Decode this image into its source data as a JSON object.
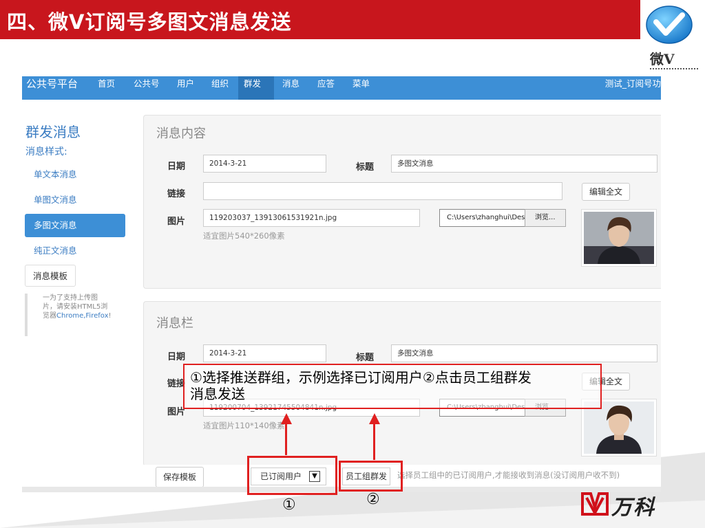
{
  "slide": {
    "title": "四、微V订阅号多图文消息发送",
    "logo_text": "微V"
  },
  "nav": {
    "brand": "公共号平台",
    "items": [
      "首页",
      "公共号",
      "用户",
      "组织",
      "群发",
      "消息",
      "应答",
      "菜单"
    ],
    "active_index": 4,
    "user": "测试_订阅号功"
  },
  "sidebar": {
    "title": "群发消息",
    "subtitle": "消息样式:",
    "items": [
      {
        "label": "单文本消息"
      },
      {
        "label": "单图文消息"
      },
      {
        "label": "多图文消息"
      },
      {
        "label": "纯正文消息"
      }
    ],
    "active_index": 2,
    "template_label": "消息模板",
    "note_line1": "一为了支持上传图",
    "note_line2": "片，请安装HTML5浏",
    "note_line3_prefix": "览器",
    "note_line3_browsers": "Chrome,Firefox",
    "note_line3_suffix": "!"
  },
  "content_panel": {
    "title": "消息内容",
    "date_label": "日期",
    "date_value": "2014-3-21",
    "title_label": "标题",
    "title_value": "多图文消息",
    "link_label": "链接",
    "link_value": "",
    "edit_button": "编辑全文",
    "image_label": "图片",
    "image_value": "119203037_13913061531921n.jpg",
    "image_hint": "适宜图片540*260像素",
    "file_path": "C:\\Users\\zhanghui\\Desl",
    "browse_button": "浏览..."
  },
  "item_panel": {
    "title": "消息栏",
    "date_label": "日期",
    "date_value": "2014-3-21",
    "title_label": "标题",
    "title_value": "多图文消息",
    "link_label": "链接",
    "edit_button": "编辑全文",
    "image_label": "图片",
    "image_value": "119200704_13921745504841n.jpg",
    "image_hint": "适宜图片110*140像素",
    "file_path": "C:\\Users\\zhanghui\\Desl",
    "browse_button": "浏览..."
  },
  "bottom": {
    "save_template": "保存模板",
    "group_select": "已订阅用户",
    "group_send": "员工组群发",
    "hint": "选择员工组中的已订阅用户,才能接收到消息(没订阅用户收不到)"
  },
  "annotation": {
    "callout_line1": "①选择推送群组，示例选择已订阅用户②点击员工组群发",
    "callout_line2": "消息发送",
    "marker_1": "①",
    "marker_2": "②"
  },
  "footer": {
    "brand": "万科"
  },
  "colors": {
    "slide_red": "#c8161d",
    "nav_blue": "#3d8fd6",
    "annotation_red": "#e02020"
  }
}
